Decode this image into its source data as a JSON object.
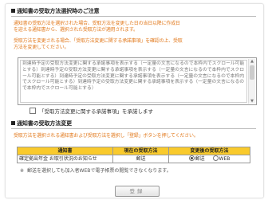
{
  "section1": {
    "title": "通知書の受取方法選択時のご注意",
    "notice_lines": [
      "通知書の受取方法を選択された場合、受取方法を変更した日の当日以降に作成日",
      "を迎える通知書から、選択された受取方法が適用されます。"
    ],
    "confirm_lines": [
      "受取方法を変更される場合、「受取方法変更に関する承諾事項」を確認の上、受取",
      "方法を変更してください。"
    ],
    "terms_text": "到達時予定の受取方法変更に関する承諾事項を表示する（一定量の文言になるので本枠内でスクロール可能とする）到達時予定の受取方法変更に関する承諾事項を表示する（一定量の文言になるので本枠内でスクロール可能とする）到達時予定の受取方法変更に関する承諾事項を表示する（一定量の文言になるので本枠内でスクロール可能とする）到達時予定の受取方法変更に関する承諾事項を表示する（一定量の文言になるので本枠内でスクロール可能とする）",
    "agree_label": "「受取方法変更に関する承諾事項」を承諾します"
  },
  "section2": {
    "title": "通知書の受取方法変更",
    "instruction": "受取方法を選択される通知書および受取方法を選択し「登録」ボタンを押してください。",
    "table": {
      "headers": [
        "通知書",
        "現在の受取方法",
        "変更後の受取方法"
      ],
      "rows": [
        {
          "name": "確定拠出年金 お取引状況のお知らせ",
          "current": "郵送",
          "options": [
            "郵送",
            "WEB"
          ],
          "selected": "郵送"
        }
      ]
    },
    "note_mark": "※",
    "note": "郵送を選択しても加入者WEBで電子帳票の閲覧できなくなります。",
    "submit_label": "登録"
  },
  "colors": {
    "accent_text": "#e27a1e",
    "table_header": "#f9ca2c",
    "border": "#999999"
  }
}
